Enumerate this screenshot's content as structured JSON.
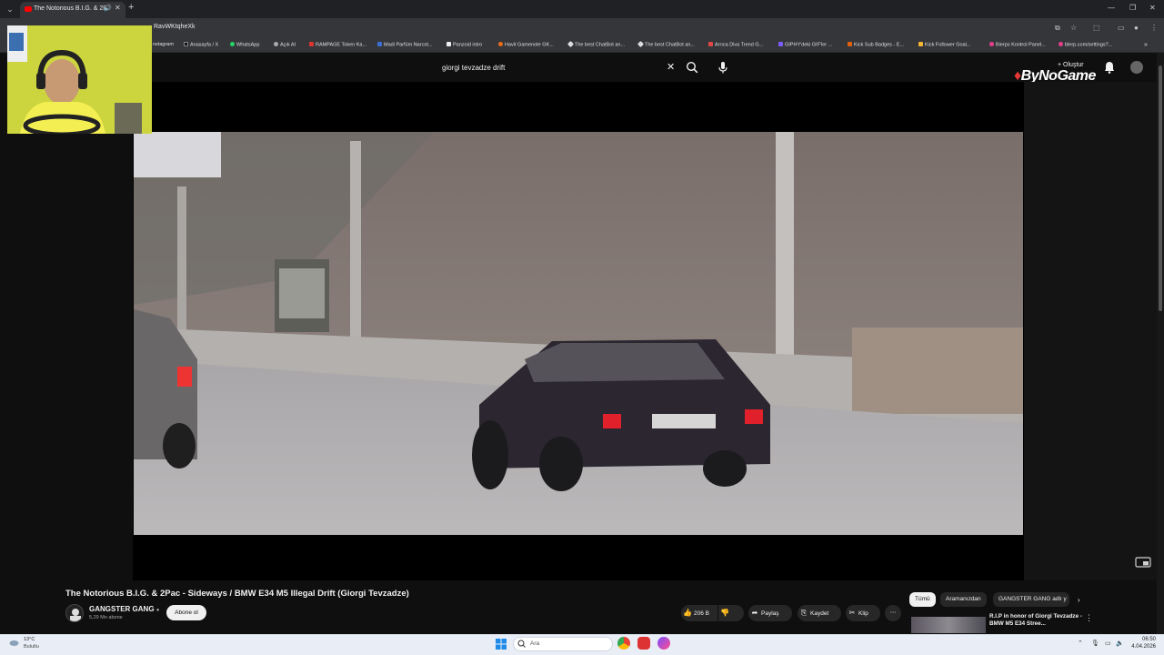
{
  "browser": {
    "tab_title": "The Notorious B.I.G. & 2Pa",
    "url_fragment": "RavWKtqheXk",
    "bookmarks": [
      "nstagram",
      "Anasayfa / X",
      "WhatsApp",
      "Açık AI",
      "RAMPAGE Token Ka...",
      "Madi Parfüm Narcot...",
      "Panzoid intro",
      "Havit Gamenote GK...",
      "The best ChatBot an...",
      "The best ChatBot an...",
      "Arrıca Diva Trend G...",
      "GIPHY'deki GIF'ler ...",
      "Kick Sub Badges - E...",
      "Kick Follower Goal...",
      "Bierps Kontrol Panel...",
      "blerp.com/settings?..."
    ]
  },
  "youtube": {
    "search_query": "giorgi tevzadze drift",
    "create_label": "Oluştur",
    "brand": "ByNoGame",
    "video": {
      "title": "The Notorious B.I.G. & 2Pac - Sideways / BMW E34 M5 Illegal Drift (Giorgi Tevzadze)",
      "channel": "GANGSTER GANG",
      "subscribers": "5,29 Mn abone",
      "subscribe_label": "Abone ol",
      "likes": "206 B",
      "share_label": "Paylaş",
      "save_label": "Kaydet",
      "clip_label": "Klip"
    },
    "chips": [
      "Tümü",
      "Aramanızdan",
      "GANGSTER GANG adlı y"
    ],
    "recommendation": {
      "title": "R.I.P in honor of Giorgi Tevzadze - BMW M5 E34 Stree..."
    }
  },
  "taskbar": {
    "temperature": "13°C",
    "weather": "Bulutlu",
    "search_placeholder": "Ara",
    "time": "06:50",
    "date": "4.04.2026"
  }
}
